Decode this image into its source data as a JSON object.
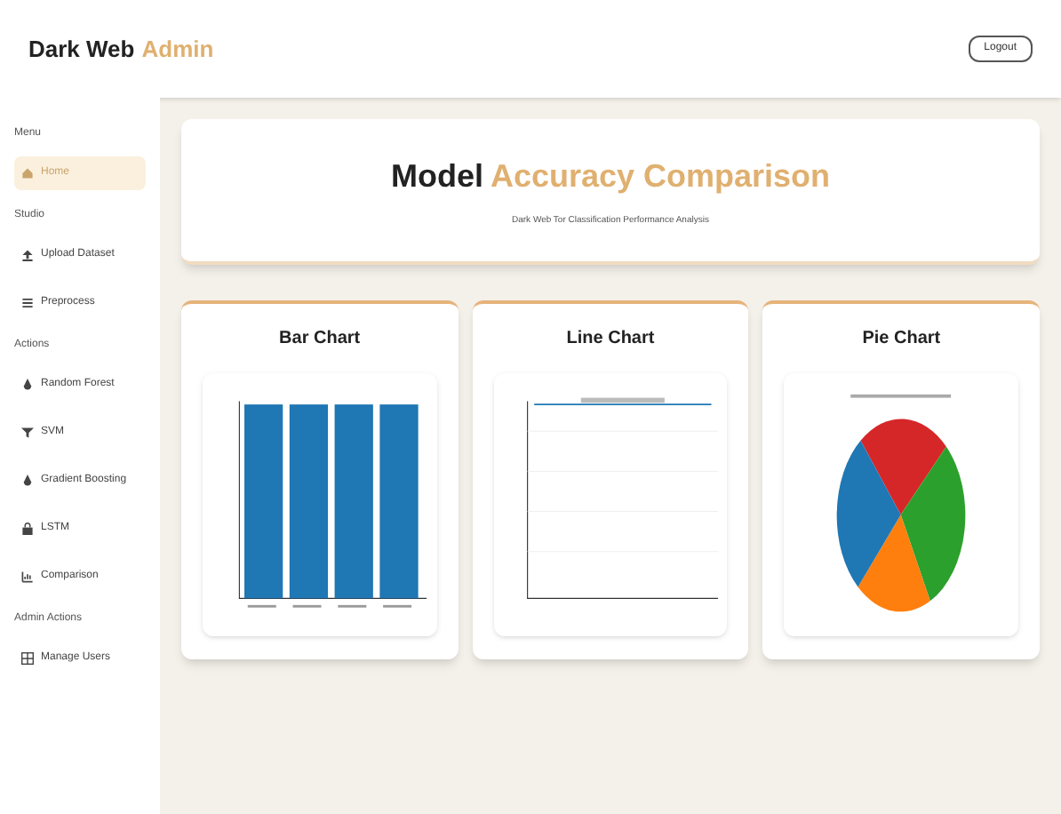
{
  "header": {
    "brand": "Dark Web",
    "brand_accent": "Admin",
    "logout": "Logout"
  },
  "sidebar": {
    "sections": [
      {
        "heading": "Menu",
        "items": [
          {
            "label": "Home",
            "kind": "home",
            "selected": true
          }
        ]
      },
      {
        "heading": "Studio",
        "items": [
          {
            "label": "Upload Dataset",
            "kind": "upload",
            "selected": false
          },
          {
            "label": "Preprocess",
            "kind": "list",
            "selected": false
          }
        ]
      },
      {
        "heading": "Actions",
        "items": [
          {
            "label": "Random Forest",
            "kind": "drop",
            "selected": false
          },
          {
            "label": "SVM",
            "kind": "filter",
            "selected": false
          },
          {
            "label": "Gradient Boosting",
            "kind": "drop",
            "selected": false
          },
          {
            "label": "LSTM",
            "kind": "lock",
            "selected": false
          },
          {
            "label": "Comparison",
            "kind": "chart",
            "selected": false
          }
        ]
      },
      {
        "heading": "Admin Actions",
        "items": [
          {
            "label": "Manage Users",
            "kind": "grid",
            "selected": false
          }
        ]
      }
    ]
  },
  "hero": {
    "title": "Model",
    "title_accent": "Accuracy Comparison",
    "subtitle": "Dark Web Tor Classification Performance Analysis"
  },
  "cards": [
    {
      "title": "Bar Chart",
      "kind": "bar"
    },
    {
      "title": "Line Chart",
      "kind": "line"
    },
    {
      "title": "Pie Chart",
      "kind": "pie"
    }
  ]
}
